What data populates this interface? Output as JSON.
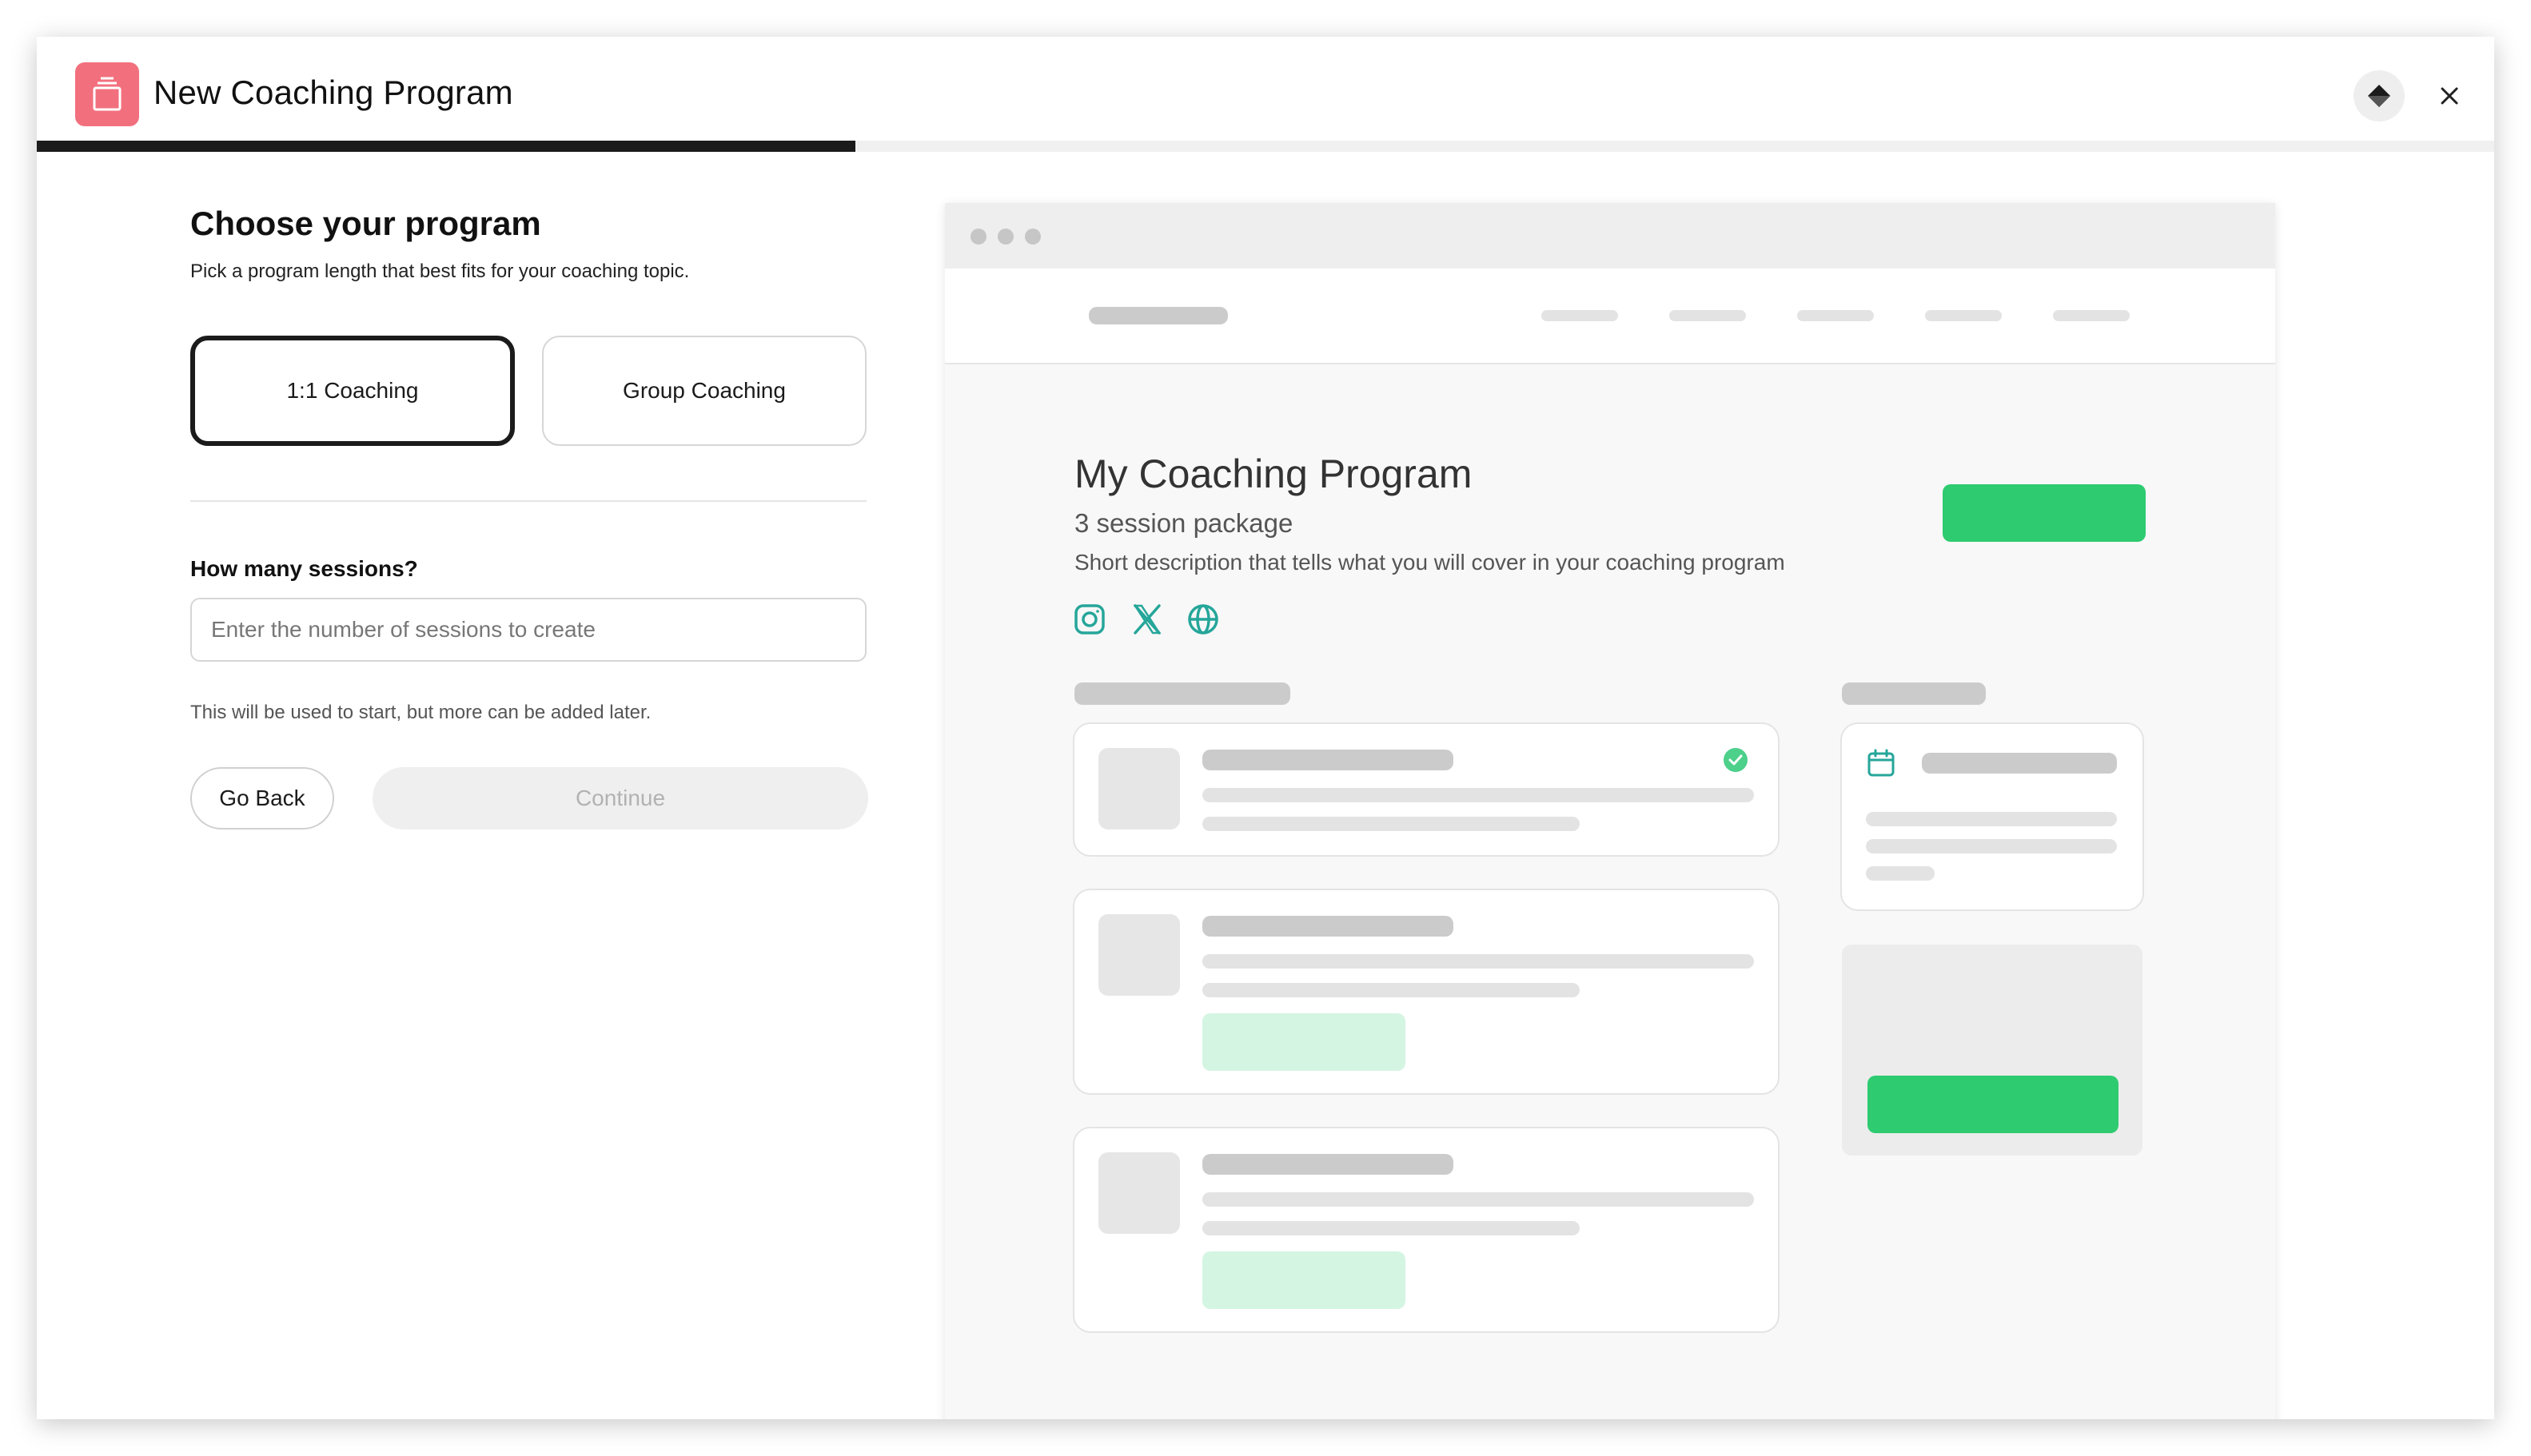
{
  "window": {
    "title": "New Coaching Program",
    "progress_fraction": 0.333
  },
  "form": {
    "heading": "Choose your program",
    "subheading": "Pick a program length that best fits for your coaching topic.",
    "options": [
      {
        "label": "1:1 Coaching",
        "selected": true
      },
      {
        "label": "Group Coaching",
        "selected": false
      }
    ],
    "sessions_label": "How many sessions?",
    "sessions_value": "",
    "sessions_placeholder": "Enter the number of sessions to create",
    "hint": "This will be used to start, but more can be added later.",
    "back_label": "Go Back",
    "continue_label": "Continue"
  },
  "preview": {
    "program_title": "My Coaching Program",
    "package": "3 session package",
    "description": "Short description that tells what you will cover in your coaching program",
    "social_icons": [
      "instagram-icon",
      "x-icon",
      "globe-icon"
    ]
  },
  "colors": {
    "brand_icon": "#f2707e",
    "accent_green": "#2ecb70",
    "mint": "#d4f5e2",
    "teal_icons": "#26a69a",
    "check_green": "#4cd08a"
  }
}
